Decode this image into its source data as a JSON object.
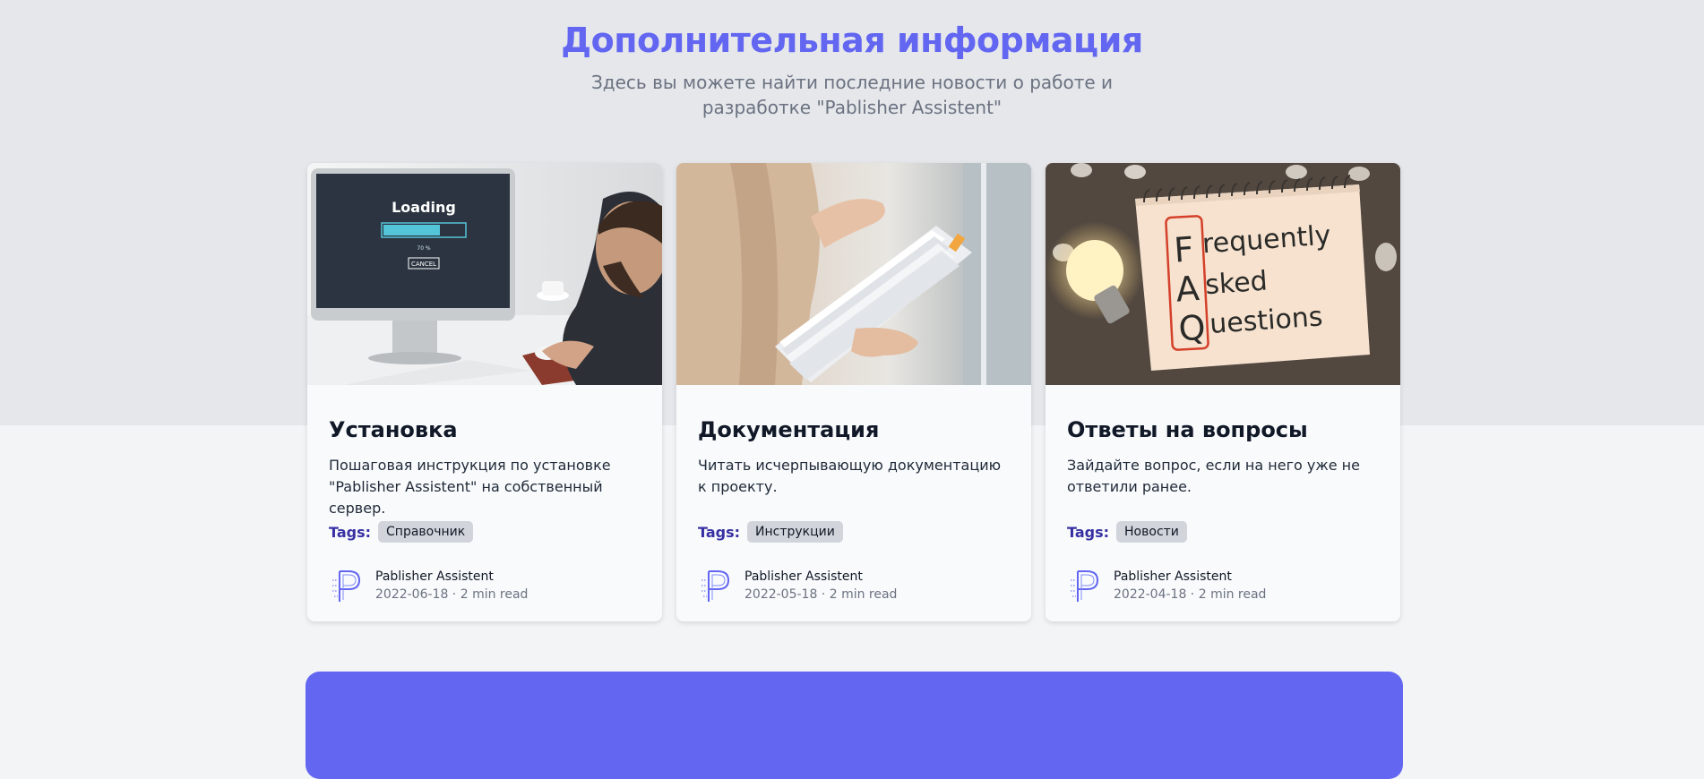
{
  "header": {
    "title": "Дополнительная информация",
    "subtitle": "Здесь вы можете найти последние новости о работе и разработке \"Pablisher Assistent\""
  },
  "colors": {
    "accent": "#6366f1",
    "tags_label": "#3730a3",
    "tag_bg": "#d1d5db",
    "top_band": "#e5e7eb",
    "page_bg": "#f3f4f6"
  },
  "cards": [
    {
      "title": "Установка",
      "description": "Пошаговая инструкция по установке \"Pablisher Assistent\" на собственный сервер.",
      "tags_label": "Tags:",
      "tag": "Справочник",
      "author": "Pablisher Assistent",
      "meta": "2022-06-18 · 2 min read",
      "image": {
        "icon": "computer-loading-photo",
        "screen_title": "Loading",
        "screen_percent": "70 %",
        "screen_button": "CANCEL",
        "progress": 0.7
      }
    },
    {
      "title": "Документация",
      "description": "Читать исчерпывающую документацию к проекту.",
      "tags_label": "Tags:",
      "tag": "Инструкции",
      "author": "Pablisher Assistent",
      "meta": "2022-05-18 · 2 min read",
      "image": {
        "icon": "document-folder-photo"
      }
    },
    {
      "title": "Ответы на вопросы",
      "description": "Зайдайте вопрос, если на него уже не ответили ранее.",
      "tags_label": "Tags:",
      "tag": "Новости",
      "author": "Pablisher Assistent",
      "meta": "2022-04-18 · 2 min read",
      "image": {
        "icon": "faq-notepad-photo",
        "line1_initial": "F",
        "line1_rest": "requently",
        "line2_initial": "A",
        "line2_rest": "sked",
        "line3_initial": "Q",
        "line3_rest": "uestions"
      }
    }
  ],
  "avatar_icon": "pablisher-logo-icon"
}
